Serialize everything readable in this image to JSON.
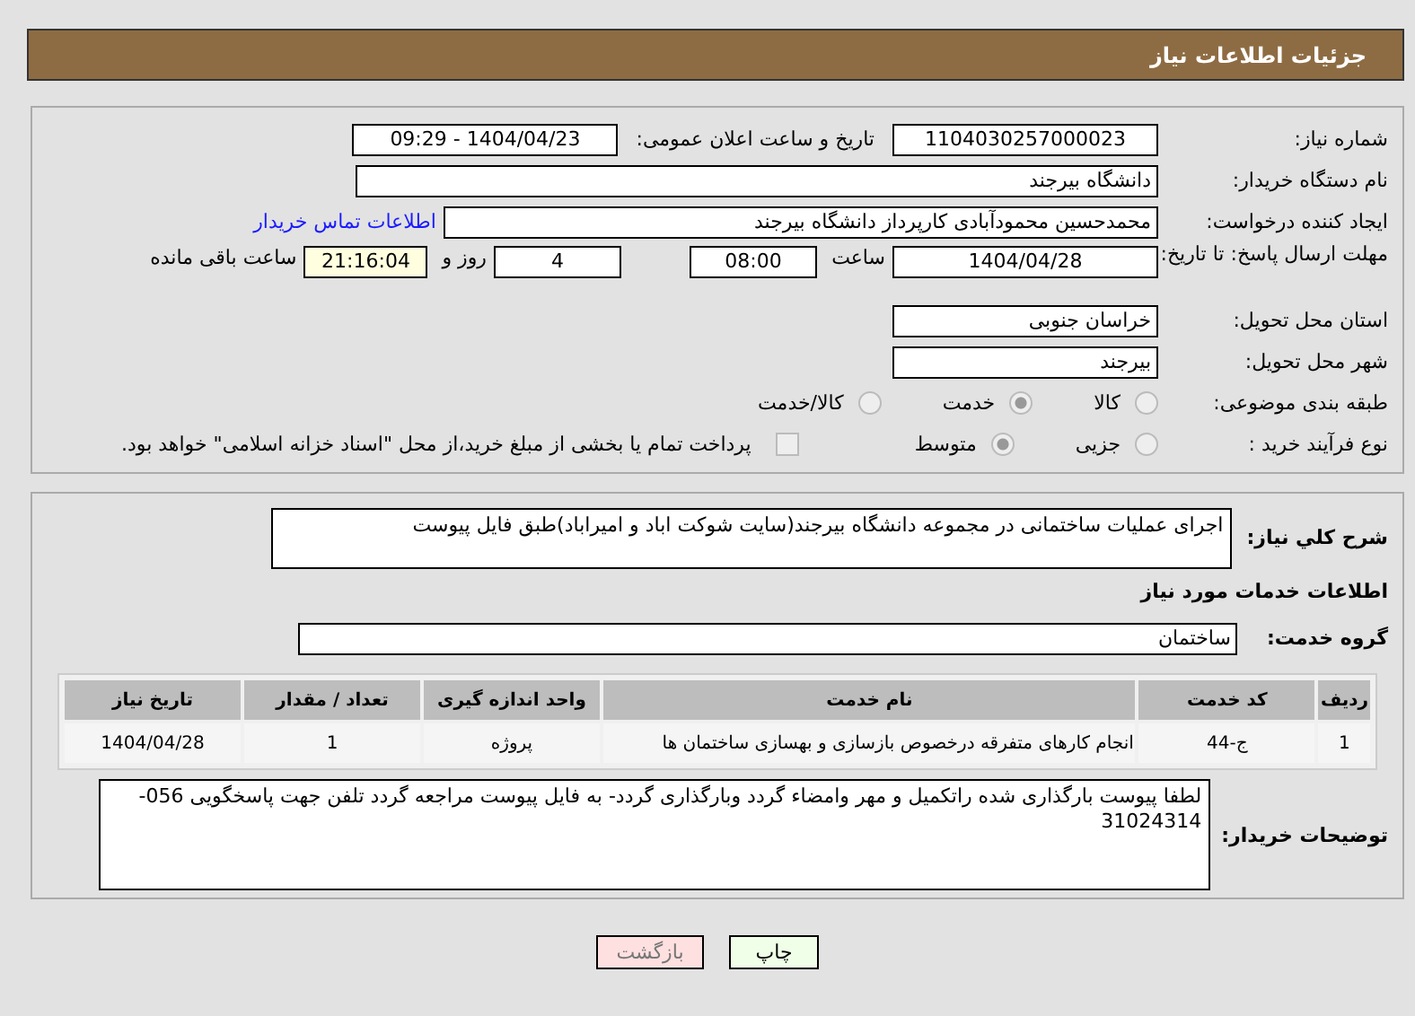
{
  "header": {
    "title": "جزئیات اطلاعات نیاز"
  },
  "details": {
    "need_number": {
      "label": "شماره نیاز:",
      "value": "1104030257000023"
    },
    "announce": {
      "label": "تاریخ و ساعت اعلان عمومی:",
      "value": "1404/04/23 - 09:29"
    },
    "buyer_org": {
      "label": "نام دستگاه خریدار:",
      "value": "دانشگاه بیرجند"
    },
    "requester": {
      "label": "ایجاد کننده درخواست:",
      "value": "محمدحسین محمودآبادی کارپرداز دانشگاه بیرجند",
      "link": "اطلاعات تماس خریدار"
    },
    "deadline": {
      "label": "مهلت ارسال پاسخ: تا تاریخ:",
      "date": "1404/04/28",
      "time_label": "ساعت",
      "time": "08:00",
      "days": "4",
      "days_label": "روز و",
      "remaining": "21:16:04",
      "remaining_label": "ساعت باقی مانده"
    },
    "province": {
      "label": "استان محل تحویل:",
      "value": "خراسان جنوبی"
    },
    "city": {
      "label": "شهر محل تحویل:",
      "value": "بیرجند"
    },
    "category": {
      "label": "طبقه بندی موضوعی:",
      "options": [
        {
          "label": "کالا",
          "selected": false
        },
        {
          "label": "خدمت",
          "selected": true
        },
        {
          "label": "کالا/خدمت",
          "selected": false
        }
      ]
    },
    "process": {
      "label": "نوع فرآیند خرید :",
      "options": [
        {
          "label": "جزیی",
          "selected": false
        },
        {
          "label": "متوسط",
          "selected": true
        }
      ],
      "payment": {
        "checked": false,
        "label": "پرداخت تمام یا بخشی از مبلغ خرید،از محل \"اسناد خزانه اسلامی\" خواهد بود."
      }
    }
  },
  "summary": {
    "label": "شرح کلي نياز:",
    "value": "اجرای عملیات ساختمانی در مجموعه دانشگاه بیرجند(سایت شوکت اباد و امیراباد)طبق فایل پیوست"
  },
  "services_heading": "اطلاعات خدمات مورد نیاز",
  "service_group": {
    "label": "گروه خدمت:",
    "value": "ساختمان"
  },
  "table": {
    "columns": [
      "ردیف",
      "کد خدمت",
      "نام خدمت",
      "واحد اندازه گیری",
      "تعداد / مقدار",
      "تاریخ نیاز"
    ],
    "rows": [
      [
        "1",
        "ج-44",
        "انجام کارهای متفرقه درخصوص بازسازی و بهسازی ساختمان ها",
        "پروژه",
        "1",
        "1404/04/28"
      ]
    ]
  },
  "notes": {
    "label": "توضیحات خریدار:",
    "value": "لطفا پیوست بارگذاری شده راتکمیل و مهر وامضاء گردد وبارگذاری گردد- به فایل پیوست مراجعه گردد تلفن جهت پاسخگویی 056-31024314"
  },
  "buttons": [
    {
      "label": "چاپ",
      "kind": "print"
    },
    {
      "label": "بازگشت",
      "kind": "back"
    }
  ]
}
